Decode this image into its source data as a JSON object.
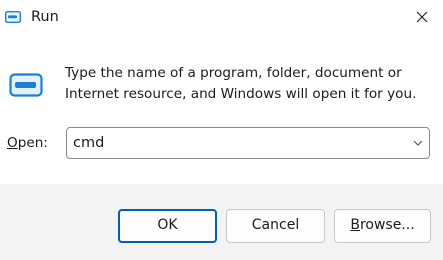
{
  "window": {
    "title": "Run",
    "close_glyph": "✕"
  },
  "icons": {
    "app": "run-icon",
    "dialog": "run-icon-large",
    "close": "close-icon",
    "dropdown": "chevron-down-icon"
  },
  "main": {
    "description_line1": "Type the name of a program, folder, document or",
    "description_line2": "Internet resource, and Windows will open it for you.",
    "open_label_mnemonic": "O",
    "open_label_rest": "pen:",
    "open_value": "cmd"
  },
  "buttons": {
    "ok": "OK",
    "cancel": "Cancel",
    "browse_mnemonic": "B",
    "browse_rest": "rowse..."
  },
  "colors": {
    "accent": "#005fb8",
    "footer_bg": "#f3f3f3",
    "icon_blue": "#1d7fd1"
  }
}
